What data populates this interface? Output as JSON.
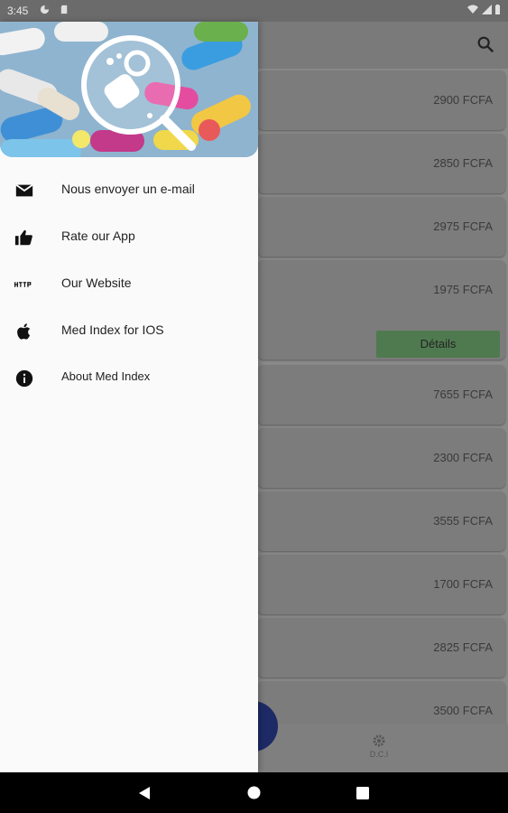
{
  "status_bar": {
    "time": "3:45"
  },
  "app": {
    "prices": [
      "2900 FCFA",
      "2850 FCFA",
      "2975 FCFA",
      "1975 FCFA",
      "7655 FCFA",
      "2300 FCFA",
      "3555 FCFA",
      "1700 FCFA",
      "2825 FCFA",
      "3500 FCFA"
    ],
    "details_label": "Détails",
    "bottom_nav": {
      "dci_label": "D.C.I"
    }
  },
  "drawer": {
    "items": [
      {
        "label": "Nous envoyer un e-mail",
        "icon": "email-icon"
      },
      {
        "label": "Rate our App",
        "icon": "thumbs-up-icon"
      },
      {
        "label": "Our Website",
        "icon": "http-icon"
      },
      {
        "label": "Med Index for IOS",
        "icon": "apple-icon"
      },
      {
        "label": "About Med Index",
        "icon": "info-icon"
      }
    ]
  },
  "colors": {
    "drawer_bg": "#fafafa",
    "scrim": "#8a8a8a",
    "details_button": "#4f7a4f",
    "fab": "#1d2a66"
  }
}
